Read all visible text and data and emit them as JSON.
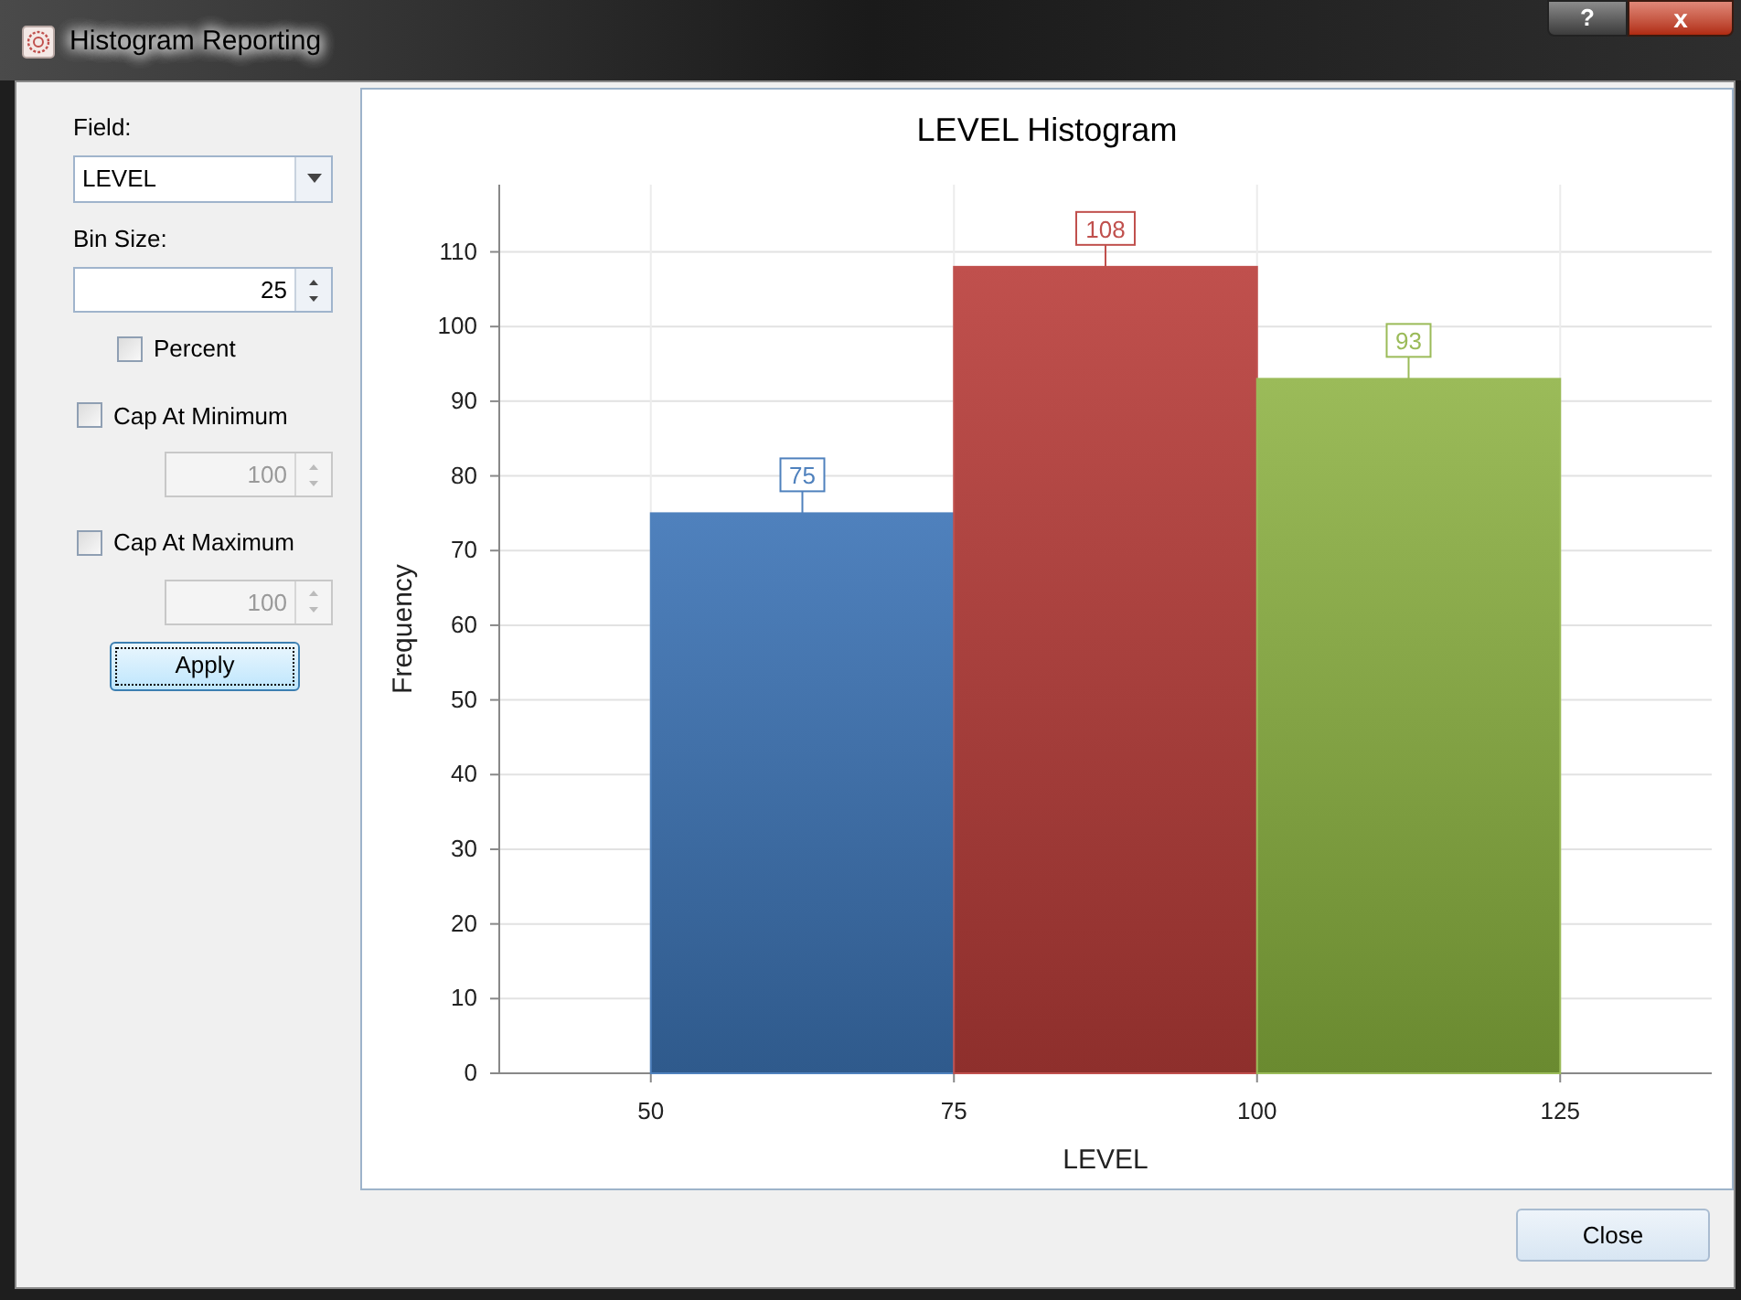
{
  "window": {
    "title": "Histogram Reporting",
    "help_button": "?",
    "close_glyph": "x"
  },
  "controls": {
    "field_label": "Field:",
    "field_value": "LEVEL",
    "bin_size_label": "Bin Size:",
    "bin_size_value": "25",
    "percent": {
      "label": "Percent",
      "checked": false
    },
    "cap_min": {
      "label": "Cap At Minimum",
      "checked": false,
      "value": "100",
      "disabled": true
    },
    "cap_max": {
      "label": "Cap At Maximum",
      "checked": false,
      "value": "100",
      "disabled": true
    },
    "apply_button": "Apply"
  },
  "chart": {
    "chart_data": {
      "type": "bar",
      "title": "LEVEL Histogram",
      "xlabel": "LEVEL",
      "ylabel": "Frequency",
      "x": [
        62.5,
        87.5,
        112.5
      ],
      "values": [
        75,
        108,
        93
      ],
      "grid": true,
      "colors": [
        "#4f81bd",
        "#c0504d",
        "#9bbb59"
      ],
      "xlim": [
        37.5,
        137.5
      ],
      "ylim": [
        0,
        119
      ],
      "xticks": [
        50,
        75,
        100,
        125
      ],
      "yticks": [
        0,
        10,
        20,
        30,
        40,
        50,
        60,
        70,
        80,
        90,
        100,
        110
      ],
      "data_labels": true
    }
  },
  "close_button": "Close"
}
